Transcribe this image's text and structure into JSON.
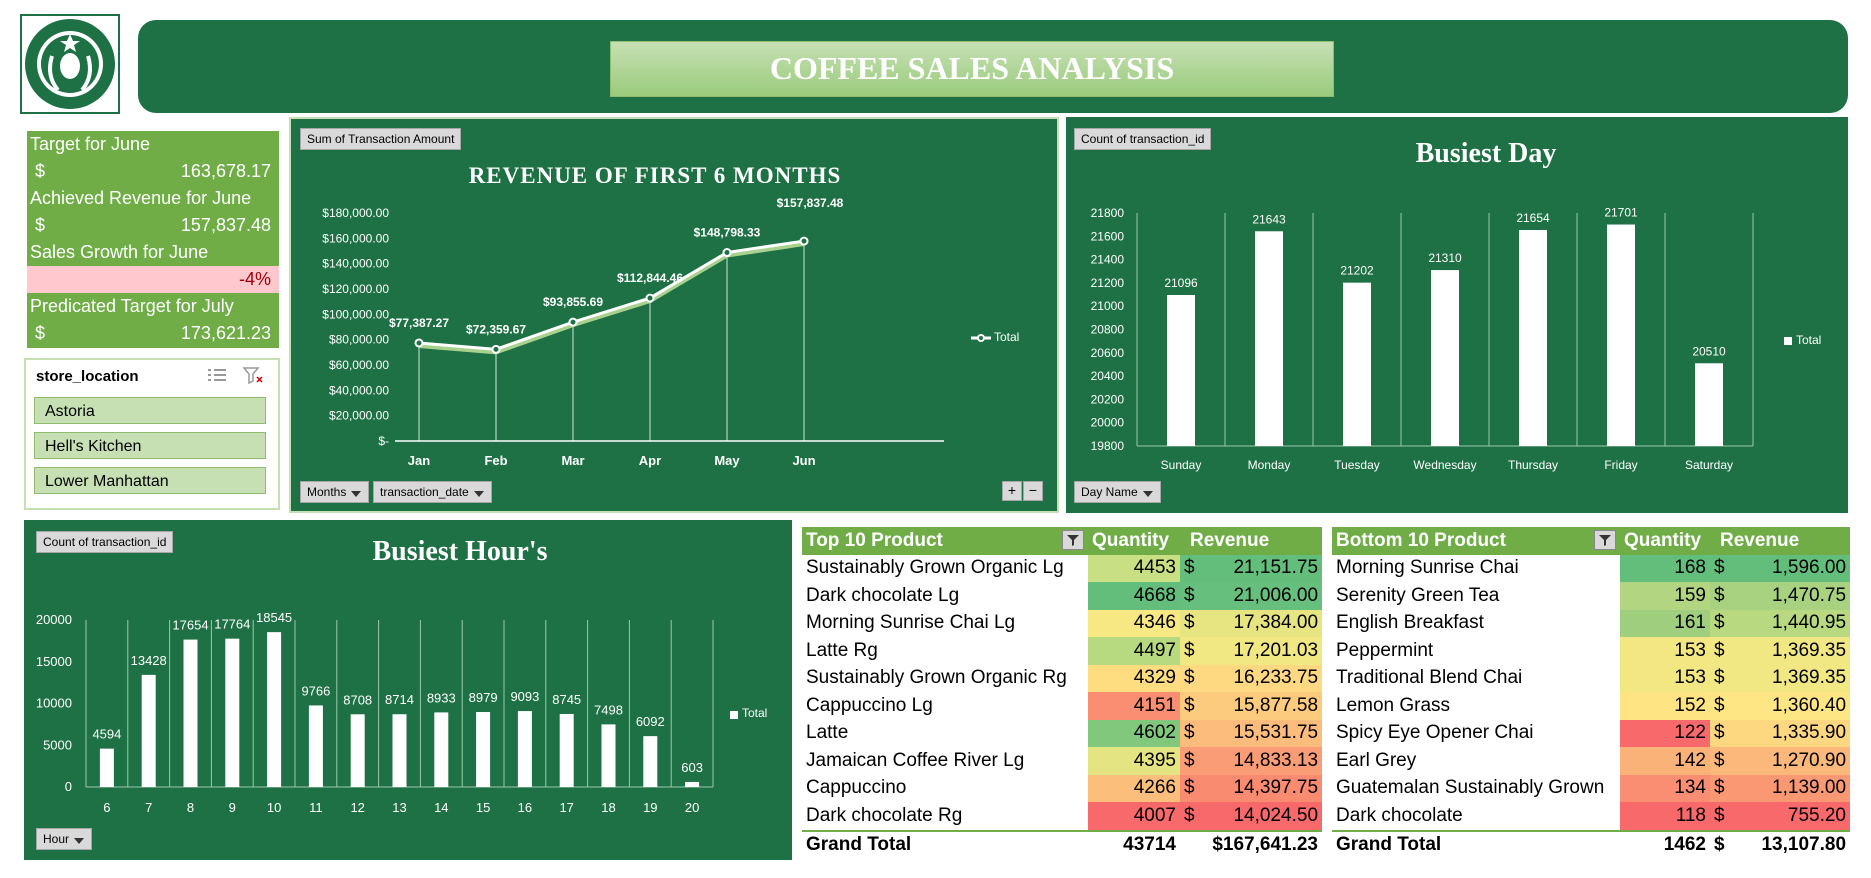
{
  "header": {
    "title": "COFFEE SALES ANALYSIS"
  },
  "kpis": {
    "target_label": "Target for June",
    "target_currency": "$",
    "target_value": "163,678.17",
    "achieved_label": "Achieved Revenue for June",
    "achieved_currency": "$",
    "achieved_value": "157,837.48",
    "growth_label": "Sales Growth for June",
    "growth_value": "-4%",
    "predicted_label": "Predicated Target for July",
    "predicted_currency": "$",
    "predicted_value": "173,621.23"
  },
  "slicer": {
    "title": "store_location",
    "items": [
      "Astoria",
      "Hell's Kitchen",
      "Lower Manhattan"
    ]
  },
  "revenue_chart": {
    "field_button": "Sum of Transaction Amount",
    "filter_months": "Months",
    "filter_date": "transaction_date",
    "legend": "Total",
    "y_ticks": [
      "$180,000.00",
      "$160,000.00",
      "$140,000.00",
      "$120,000.00",
      "$100,000.00",
      "$80,000.00",
      "$60,000.00",
      "$40,000.00",
      "$20,000.00",
      "$-"
    ],
    "data_labels": [
      "$77,387.27",
      "$72,359.67",
      "$93,855.69",
      "$112,844.46",
      "$148,798.33",
      "$157,837.48"
    ]
  },
  "day_chart": {
    "field_button": "Count of transaction_id",
    "filter": "Day Name",
    "legend": "Total",
    "y_ticks": [
      "21800",
      "21600",
      "21400",
      "21200",
      "21000",
      "20800",
      "20600",
      "20400",
      "20200",
      "20000",
      "19800"
    ]
  },
  "hour_chart": {
    "field_button": "Count of transaction_id",
    "filter": "Hour",
    "legend": "Total",
    "y_ticks": [
      "20000",
      "15000",
      "10000",
      "5000",
      "0"
    ]
  },
  "chart_data": [
    {
      "type": "line",
      "title": "REVENUE OF FIRST 6 MONTHS",
      "categories": [
        "Jan",
        "Feb",
        "Mar",
        "Apr",
        "May",
        "Jun"
      ],
      "series": [
        {
          "name": "Total",
          "values": [
            77387.27,
            72359.67,
            93855.69,
            112844.46,
            148798.33,
            157837.48
          ]
        }
      ],
      "ylim": [
        0,
        180000
      ],
      "legend": "right",
      "grid": false
    },
    {
      "type": "bar",
      "title": "Busiest Day",
      "categories": [
        "Sunday",
        "Monday",
        "Tuesday",
        "Wednesday",
        "Thursday",
        "Friday",
        "Saturday"
      ],
      "series": [
        {
          "name": "Total",
          "values": [
            21096,
            21643,
            21202,
            21310,
            21654,
            21701,
            20510
          ]
        }
      ],
      "ylim": [
        19800,
        21800
      ],
      "legend": "right",
      "grid": true
    },
    {
      "type": "bar",
      "title": "Busiest Hour's",
      "categories": [
        "6",
        "7",
        "8",
        "9",
        "10",
        "11",
        "12",
        "13",
        "14",
        "15",
        "16",
        "17",
        "18",
        "19",
        "20"
      ],
      "series": [
        {
          "name": "Total",
          "values": [
            4594,
            13428,
            17654,
            17764,
            18545,
            9766,
            8708,
            8714,
            8933,
            8979,
            9093,
            8745,
            7498,
            6092,
            603
          ]
        }
      ],
      "ylim": [
        0,
        20000
      ],
      "legend": "right",
      "grid": true
    }
  ],
  "top10": {
    "headers": [
      "Top 10 Product",
      "Quantity",
      "Revenue"
    ],
    "currency": "$",
    "rows": [
      {
        "name": "Sustainably Grown Organic Lg",
        "qty": "4453",
        "rev": "21,151.75",
        "qc": "#c9df84",
        "rc": "#63be7b"
      },
      {
        "name": "Dark chocolate Lg",
        "qty": "4668",
        "rev": "21,006.00",
        "qc": "#63be7b",
        "rc": "#66bf7c"
      },
      {
        "name": "Morning Sunrise Chai Lg",
        "qty": "4346",
        "rev": "17,384.00",
        "qc": "#f7e883",
        "rc": "#e7e482"
      },
      {
        "name": "Latte Rg",
        "qty": "4497",
        "rev": "17,201.03",
        "qc": "#b7d980",
        "rc": "#f1e783"
      },
      {
        "name": "Sustainably Grown Organic Rg",
        "qty": "4329",
        "rev": "16,233.75",
        "qc": "#fedd81",
        "rc": "#fed981"
      },
      {
        "name": "Cappuccino Lg",
        "qty": "4151",
        "rev": "15,877.58",
        "qc": "#f98e72",
        "rc": "#fdcb7d"
      },
      {
        "name": "Latte",
        "qty": "4602",
        "rev": "15,531.75",
        "qc": "#81c87d",
        "rc": "#fcbc7b"
      },
      {
        "name": "Jamaican Coffee River Lg",
        "qty": "4395",
        "rev": "14,833.13",
        "qc": "#e5e482",
        "rc": "#fa9c75"
      },
      {
        "name": "Cappuccino",
        "qty": "4266",
        "rev": "14,397.75",
        "qc": "#fcbf7b",
        "rc": "#f98b71"
      },
      {
        "name": "Dark chocolate Rg",
        "qty": "4007",
        "rev": "14,024.50",
        "qc": "#f8696b",
        "rc": "#f8696b"
      }
    ],
    "total_label": "Grand Total",
    "total_qty": "43714",
    "total_rev": "$167,641.23"
  },
  "bottom10": {
    "headers": [
      "Bottom 10 Product",
      "Quantity",
      "Revenue"
    ],
    "currency": "$",
    "rows": [
      {
        "name": "Morning Sunrise Chai",
        "qty": "168",
        "rev": "1,596.00",
        "qc": "#63be7b",
        "rc": "#63be7b"
      },
      {
        "name": "Serenity Green Tea",
        "qty": "159",
        "rev": "1,470.75",
        "qc": "#b1d580",
        "rc": "#a8d27f"
      },
      {
        "name": "English Breakfast",
        "qty": "161",
        "rev": "1,440.95",
        "qc": "#9fcf7e",
        "rc": "#b8d980"
      },
      {
        "name": "Peppermint",
        "qty": "153",
        "rev": "1,369.35",
        "qc": "#f2e783",
        "rc": "#f1e783"
      },
      {
        "name": "Traditional Blend Chai",
        "qty": "153",
        "rev": "1,369.35",
        "qc": "#f2e783",
        "rc": "#f1e783"
      },
      {
        "name": "Lemon Grass",
        "qty": "152",
        "rev": "1,360.40",
        "qc": "#ffe483",
        "rc": "#ffe684"
      },
      {
        "name": "Spicy Eye Opener Chai",
        "qty": "122",
        "rev": "1,335.90",
        "qc": "#f8696b",
        "rc": "#fed880"
      },
      {
        "name": "Earl Grey",
        "qty": "142",
        "rev": "1,270.90",
        "qc": "#fbb279",
        "rc": "#fcb87a"
      },
      {
        "name": "Guatemalan Sustainably Grown",
        "qty": "134",
        "rev": "1,139.00",
        "qc": "#f98e72",
        "rc": "#fa9874"
      },
      {
        "name": "Dark chocolate",
        "qty": "118",
        "rev": "755.20",
        "qc": "#f8696b",
        "rc": "#f8696b"
      }
    ],
    "total_label": "Grand Total",
    "total_qty": "1462",
    "total_currency": "$",
    "total_rev": "13,107.80"
  },
  "colors": {
    "brand_green": "#1e7145",
    "light_green": "#70ad47",
    "negative": "#ffc7ce",
    "negative_text": "#9c0006"
  },
  "icons": {
    "logo": "starbucks-siren-logo",
    "multiselect": "multi-select-icon",
    "clear_filter": "clear-filter-icon",
    "filter": "filter-icon"
  }
}
